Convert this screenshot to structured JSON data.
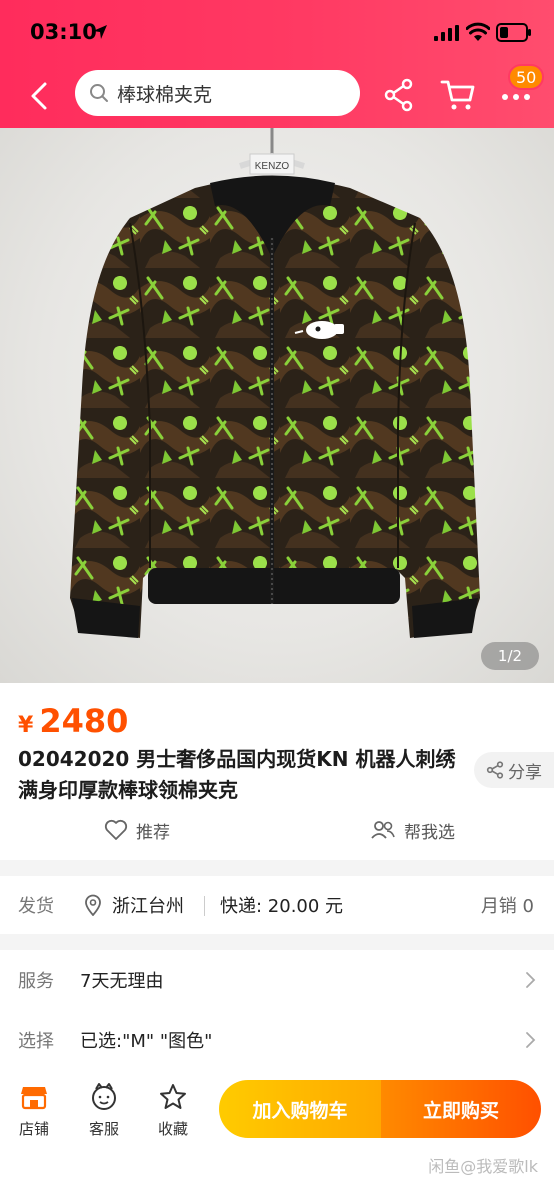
{
  "status_bar": {
    "time": "03:10"
  },
  "header": {
    "search_text": "棒球棉夹克",
    "more_badge": "50"
  },
  "gallery": {
    "page_indicator": "1/2",
    "brand_tag": "KENZO"
  },
  "product": {
    "currency": "¥",
    "price": "2480",
    "title": "02042020 男士奢侈品国内现货KN 机器人刺绣满身印厚款棒球领棉夹克",
    "share_label": "分享"
  },
  "actions": {
    "recommend": "推荐",
    "help_me_choose": "帮我选"
  },
  "shipping": {
    "label": "发货",
    "location": "浙江台州",
    "express": "快递: 20.00 元",
    "monthly_sales": "月销 0"
  },
  "service": {
    "label": "服务",
    "value": "7天无理由"
  },
  "selection": {
    "label": "选择",
    "value": "已选:\"M\" \"图色\""
  },
  "bottom_bar": {
    "store": "店铺",
    "customer_service": "客服",
    "favorite": "收藏",
    "add_to_cart": "加入购物车",
    "buy_now": "立即购买"
  },
  "watermark": "闲鱼@我爱歌lk",
  "colors": {
    "header": "#ff3a63",
    "price": "#ff5000",
    "cart_button": "#ffb800",
    "buy_button": "#ff6a00",
    "badge": "#ff8a00"
  }
}
